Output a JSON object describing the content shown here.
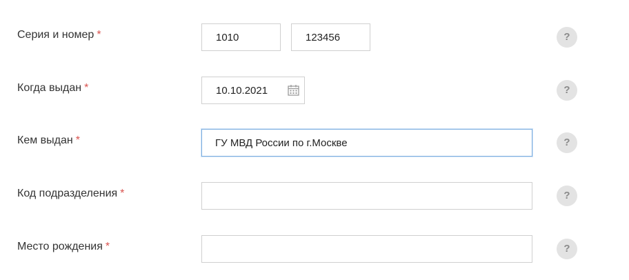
{
  "fields": [
    {
      "label": "Серия и номер",
      "required_mark": "*",
      "series_value": "1010",
      "number_value": "123456",
      "help_label": "?"
    },
    {
      "label": "Когда выдан",
      "required_mark": "*",
      "value": "10.10.2021",
      "icon": "calendar-icon",
      "help_label": "?"
    },
    {
      "label": "Кем выдан",
      "required_mark": "*",
      "value": "ГУ МВД России по г.Москве",
      "help_label": "?"
    },
    {
      "label": "Код подразделения",
      "required_mark": "*",
      "value": "",
      "help_label": "?"
    },
    {
      "label": "Место рождения",
      "required_mark": "*",
      "value": "",
      "help_label": "?"
    }
  ],
  "colors": {
    "required": "#d9534f",
    "input_border": "#cfcfcf",
    "focus_border": "#7fb0e0",
    "help_bg": "#e3e3e3",
    "help_text": "#8a8a8a"
  }
}
